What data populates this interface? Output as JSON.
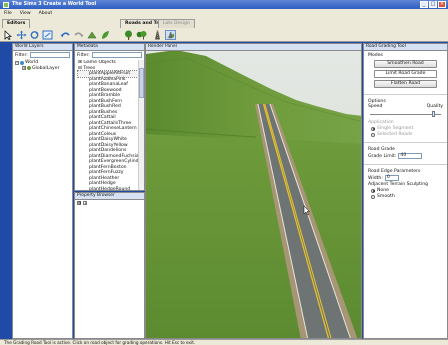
{
  "window": {
    "title": "The Sims 3 Create a World Tool"
  },
  "menu": [
    "File",
    "View",
    "About"
  ],
  "ribbon_tabs": [
    {
      "label": "Editors",
      "active": true
    },
    {
      "label": "Roads and Trees",
      "active": true
    },
    {
      "label": "Lots Design",
      "active": false
    }
  ],
  "world_layers": {
    "title": "World Layers",
    "filter_label": "Filter:",
    "root": "World",
    "child": "GlobalLayer"
  },
  "metadata": {
    "title": "Metadata",
    "filter_label": "Filter:",
    "groups": [
      "Game Objects",
      "Trees"
    ],
    "items": [
      "plantAppleAltFruit",
      "plantAzaleaPink",
      "plantBananaLeaf",
      "plantBoxwood",
      "plantBramble",
      "plantBushFern",
      "plantBushRed",
      "plantBushes",
      "plantCattail",
      "plantCattailsThree",
      "plantChineseLantern",
      "plantColeus",
      "plantDaisyWhite",
      "plantDaisyYellow",
      "plantDandelions",
      "plantDiamondFuchsia",
      "plantEvergreenCylinder",
      "plantFernBoston",
      "plantFernFuzzy",
      "plantHeather",
      "plantHedge",
      "plantHedgeRound"
    ]
  },
  "property_browser": {
    "title": "Property Browser"
  },
  "viewport": {
    "title": "Render Panel"
  },
  "road_tool": {
    "title": "Road Grading Tool",
    "modes_label": "Modes",
    "buttons": [
      "Smoothen Road",
      "Limit Road Grade",
      "Flatten Road"
    ],
    "options_label": "Options",
    "speed_label": "Speed",
    "quality_label": "Quality",
    "application_label": "Application",
    "app_option_1": "Single Segment",
    "app_option_2": "Selected Roads",
    "road_grade_label": "Road Grade",
    "grade_limit_label": "Grade Limit:",
    "grade_limit_value": "40",
    "road_edge_label": "Road Edge Parameters",
    "width_label": "Width:",
    "width_value": "0",
    "adjacent_label": "Adjacent Terrain Sculpting",
    "sculpt_none": "None",
    "sculpt_smooth": "Smooth"
  },
  "status": {
    "text": "The Grading Road Tool is active. Click on road object for grading operations. Hit Esc to exit."
  },
  "colors": {
    "titlebar": "#2d5fc3",
    "sky": "#dfe5dc",
    "grass": "#6f9b3c",
    "road": "#6e7373",
    "centerline": "#e3c12c"
  }
}
